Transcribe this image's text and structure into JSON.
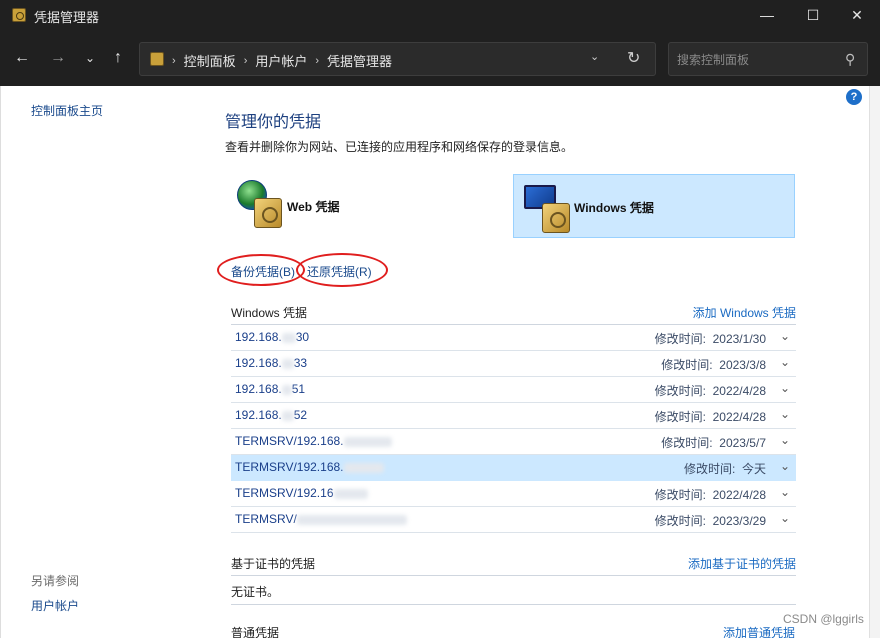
{
  "window": {
    "title": "凭据管理器",
    "minimize": "—",
    "maximize": "☐",
    "close": "✕"
  },
  "toolbar": {
    "back": "←",
    "forward": "→",
    "recent": "⌄",
    "up": "↑",
    "breadcrumbs": [
      "控制面板",
      "用户帐户",
      "凭据管理器"
    ],
    "separator": "›",
    "dropdown": "⌄",
    "refresh": "↻",
    "search_placeholder": "搜索控制面板",
    "search_glyph": "⚲"
  },
  "sidebar": {
    "home": "控制面板主页",
    "see_also": "另请参阅",
    "user_accounts": "用户帐户"
  },
  "main": {
    "title": "管理你的凭据",
    "description": "查看并删除你为网站、已连接的应用程序和网络保存的登录信息。",
    "tiles": {
      "web": "Web 凭据",
      "windows": "Windows 凭据",
      "selected": "windows"
    },
    "actions": {
      "backup": "备份凭据(B)",
      "restore": "还原凭据(R)"
    },
    "windows_section": {
      "title": "Windows 凭据",
      "add": "添加 Windows 凭据",
      "rows": [
        {
          "name": "192.168.",
          "name_tail": "30",
          "date_label": "修改时间:",
          "date": "2023/1/30",
          "selected": false
        },
        {
          "name": "192.168.",
          "name_tail": "33",
          "date_label": "修改时间:",
          "date": "2023/3/8",
          "selected": false
        },
        {
          "name": "192.168.",
          "name_tail": "51",
          "date_label": "修改时间:",
          "date": "2022/4/28",
          "selected": false
        },
        {
          "name": "192.168.",
          "name_tail": "52",
          "date_label": "修改时间:",
          "date": "2022/4/28",
          "selected": false
        },
        {
          "name": "TERMSRV/192.168.",
          "name_tail": "",
          "date_label": "修改时间:",
          "date": "2023/5/7",
          "selected": false
        },
        {
          "name": "TERMSRV/192.168.",
          "name_tail": "",
          "date_label": "修改时间:",
          "date": "今天",
          "selected": true
        },
        {
          "name": "TERMSRV/192.16",
          "name_tail": "",
          "date_label": "修改时间:",
          "date": "2022/4/28",
          "selected": false
        },
        {
          "name": "TERMSRV/",
          "name_tail": "",
          "date_label": "修改时间:",
          "date": "2023/3/29",
          "selected": false
        }
      ]
    },
    "cert_section": {
      "title": "基于证书的凭据",
      "add": "添加基于证书的凭据",
      "empty": "无证书。"
    },
    "generic_section": {
      "title": "普通凭据",
      "add": "添加普通凭据"
    }
  },
  "help": "?",
  "watermark": "CSDN @lggirls",
  "chevron": "⌄",
  "colors": {
    "accent": "#1a6ac2",
    "selected_bg": "#cce8ff",
    "annotation_red": "#e01e1e",
    "title_blue": "#1c3f7f"
  }
}
